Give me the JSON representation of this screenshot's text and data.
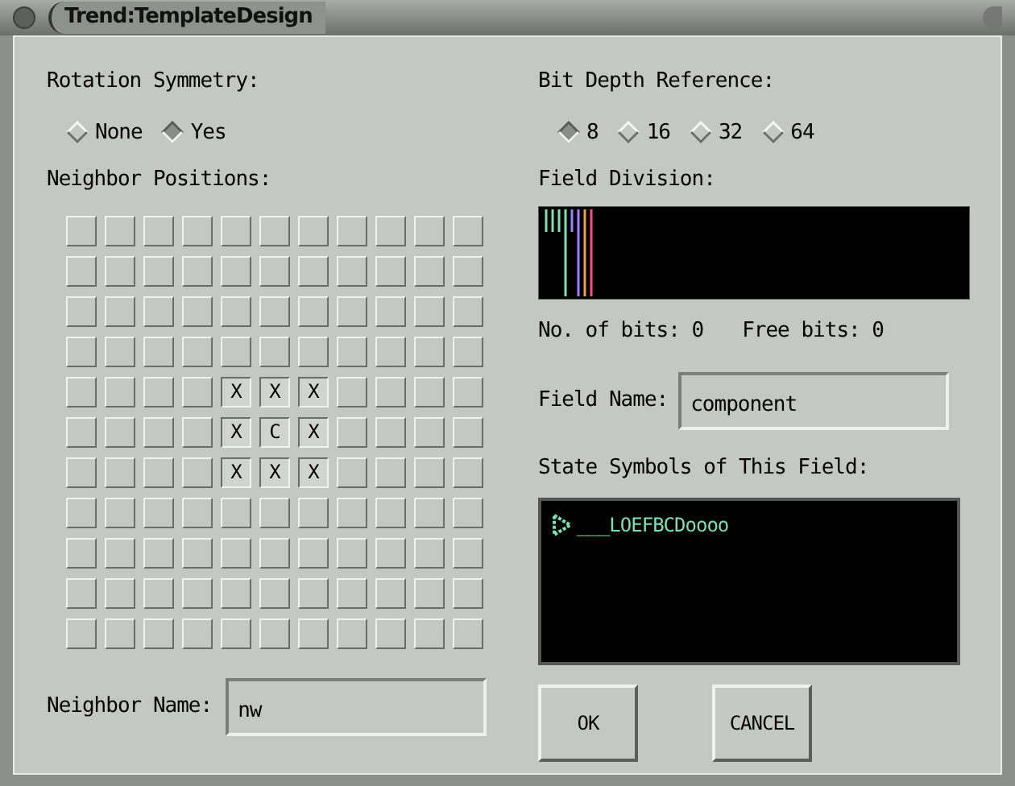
{
  "window": {
    "title": "Trend:TemplateDesign"
  },
  "rotation_symmetry": {
    "label": "Rotation Symmetry:",
    "options": [
      {
        "label": "None",
        "selected": false
      },
      {
        "label": "Yes",
        "selected": true
      }
    ]
  },
  "neighbor_positions": {
    "label": "Neighbor Positions:",
    "rows": [
      {
        "cells": [
          {
            "marked": false
          },
          {
            "marked": false
          },
          {
            "marked": false
          },
          {
            "marked": false
          },
          {
            "marked": false
          },
          {
            "marked": false
          },
          {
            "marked": false
          },
          {
            "marked": false
          },
          {
            "marked": false
          },
          {
            "marked": false
          },
          {
            "marked": false
          }
        ]
      },
      {
        "cells": [
          {
            "marked": false
          },
          {
            "marked": false
          },
          {
            "marked": false
          },
          {
            "marked": false
          },
          {
            "marked": false
          },
          {
            "marked": false
          },
          {
            "marked": false
          },
          {
            "marked": false
          },
          {
            "marked": false
          },
          {
            "marked": false
          },
          {
            "marked": false
          }
        ]
      },
      {
        "cells": [
          {
            "marked": false
          },
          {
            "marked": false
          },
          {
            "marked": false
          },
          {
            "marked": false
          },
          {
            "marked": false
          },
          {
            "marked": false
          },
          {
            "marked": false
          },
          {
            "marked": false
          },
          {
            "marked": false
          },
          {
            "marked": false
          },
          {
            "marked": false
          }
        ]
      },
      {
        "cells": [
          {
            "marked": false
          },
          {
            "marked": false
          },
          {
            "marked": false
          },
          {
            "marked": false
          },
          {
            "marked": false
          },
          {
            "marked": false
          },
          {
            "marked": false
          },
          {
            "marked": false
          },
          {
            "marked": false
          },
          {
            "marked": false
          },
          {
            "marked": false
          }
        ]
      },
      {
        "cells": [
          {
            "marked": false
          },
          {
            "marked": false
          },
          {
            "marked": false
          },
          {
            "marked": false
          },
          {
            "marked": true,
            "label": "X"
          },
          {
            "marked": true,
            "label": "X"
          },
          {
            "marked": true,
            "label": "X"
          },
          {
            "marked": false
          },
          {
            "marked": false
          },
          {
            "marked": false
          },
          {
            "marked": false
          }
        ]
      },
      {
        "cells": [
          {
            "marked": false
          },
          {
            "marked": false
          },
          {
            "marked": false
          },
          {
            "marked": false
          },
          {
            "marked": true,
            "label": "X"
          },
          {
            "marked": true,
            "label": "C"
          },
          {
            "marked": true,
            "label": "X"
          },
          {
            "marked": false
          },
          {
            "marked": false
          },
          {
            "marked": false
          },
          {
            "marked": false
          }
        ]
      },
      {
        "cells": [
          {
            "marked": false
          },
          {
            "marked": false
          },
          {
            "marked": false
          },
          {
            "marked": false
          },
          {
            "marked": true,
            "label": "X"
          },
          {
            "marked": true,
            "label": "X"
          },
          {
            "marked": true,
            "label": "X"
          },
          {
            "marked": false
          },
          {
            "marked": false
          },
          {
            "marked": false
          },
          {
            "marked": false
          }
        ]
      },
      {
        "cells": [
          {
            "marked": false
          },
          {
            "marked": false
          },
          {
            "marked": false
          },
          {
            "marked": false
          },
          {
            "marked": false
          },
          {
            "marked": false
          },
          {
            "marked": false
          },
          {
            "marked": false
          },
          {
            "marked": false
          },
          {
            "marked": false
          },
          {
            "marked": false
          }
        ]
      },
      {
        "cells": [
          {
            "marked": false
          },
          {
            "marked": false
          },
          {
            "marked": false
          },
          {
            "marked": false
          },
          {
            "marked": false
          },
          {
            "marked": false
          },
          {
            "marked": false
          },
          {
            "marked": false
          },
          {
            "marked": false
          },
          {
            "marked": false
          },
          {
            "marked": false
          }
        ]
      },
      {
        "cells": [
          {
            "marked": false
          },
          {
            "marked": false
          },
          {
            "marked": false
          },
          {
            "marked": false
          },
          {
            "marked": false
          },
          {
            "marked": false
          },
          {
            "marked": false
          },
          {
            "marked": false
          },
          {
            "marked": false
          },
          {
            "marked": false
          },
          {
            "marked": false
          }
        ]
      },
      {
        "cells": [
          {
            "marked": false
          },
          {
            "marked": false
          },
          {
            "marked": false
          },
          {
            "marked": false
          },
          {
            "marked": false
          },
          {
            "marked": false
          },
          {
            "marked": false
          },
          {
            "marked": false
          },
          {
            "marked": false
          },
          {
            "marked": false
          },
          {
            "marked": false
          }
        ]
      }
    ]
  },
  "neighbor_name": {
    "label": "Neighbor Name:",
    "value": "nw"
  },
  "bit_depth": {
    "label": "Bit Depth Reference:",
    "options": [
      {
        "label": "8",
        "selected": true
      },
      {
        "label": "16",
        "selected": false
      },
      {
        "label": "32",
        "selected": false
      },
      {
        "label": "64",
        "selected": false
      }
    ]
  },
  "field_division": {
    "label": "Field Division:"
  },
  "bits": {
    "count_label": "No. of bits: 0",
    "free_label": "Free bits: 0"
  },
  "field_name": {
    "label": "Field Name:",
    "value": "component"
  },
  "state_symbols": {
    "label": "State Symbols of This Field:",
    "items": [
      {
        "text": "___LOEFBCDoooo"
      }
    ]
  },
  "buttons": [
    {
      "label": "OK"
    },
    {
      "label": "CANCEL"
    }
  ]
}
